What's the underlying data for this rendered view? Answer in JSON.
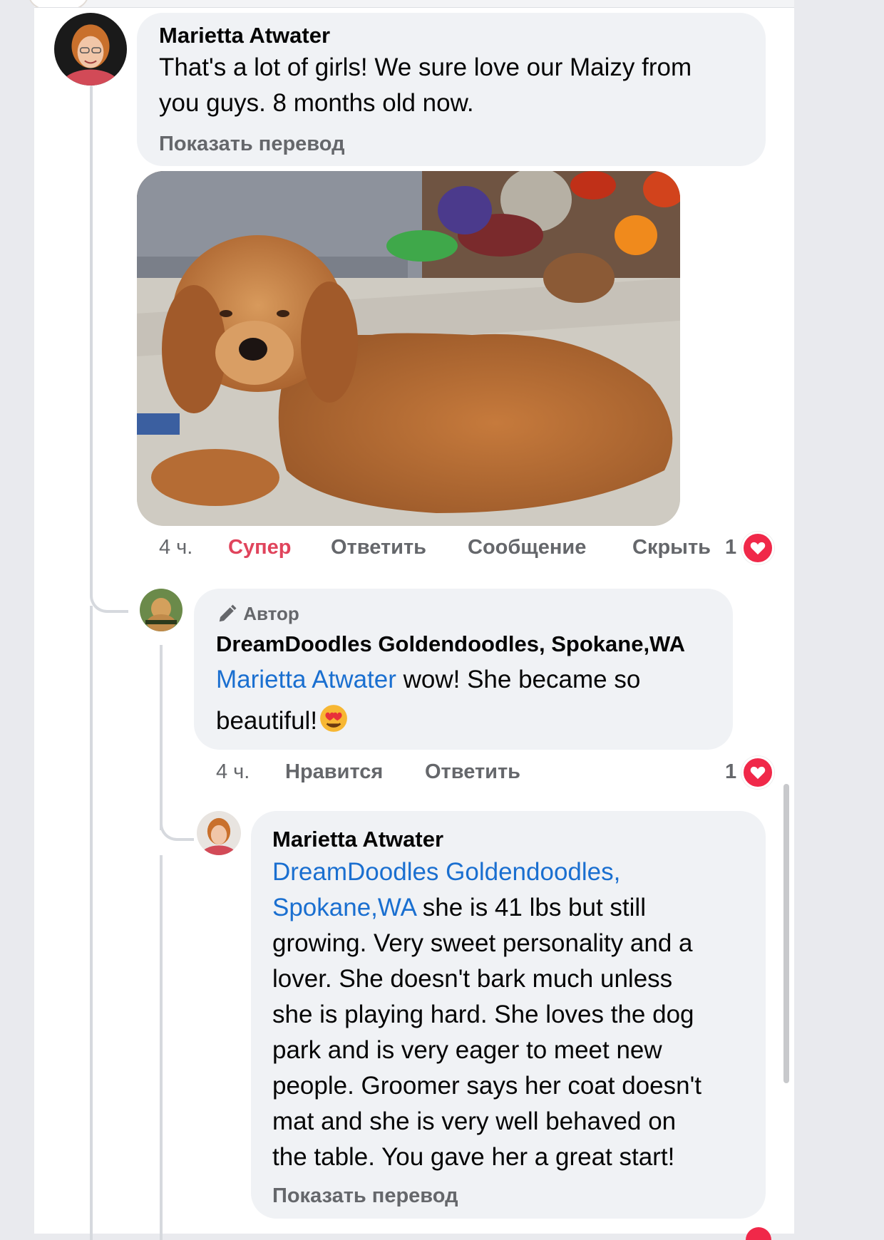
{
  "comment1": {
    "author": "Marietta Atwater",
    "line1": "That's a lot of girls! We sure love our Maizy from",
    "line2": "you guys. 8 months old now.",
    "translate": "Показать перевод",
    "photo_alt": "",
    "actions": {
      "time": "4 ч.",
      "react": "Супер",
      "reply": "Ответить",
      "message": "Сообщение",
      "hide": "Скрыть",
      "count": "1"
    }
  },
  "reply1": {
    "badge": "Автор",
    "author": "DreamDoodles Goldendoodles, Spokane,WA",
    "mention": "Marietta Atwater",
    "line1_rest": " wow! She became so",
    "line2": "beautiful!",
    "actions": {
      "time": "4 ч.",
      "like": "Нравится",
      "reply": "Ответить",
      "count": "1"
    }
  },
  "reply2": {
    "author": "Marietta Atwater",
    "mention_line1": "DreamDoodles Goldendoodles,",
    "mention_line2": "Spokane,WA",
    "line2_rest": " she is 41 lbs but still",
    "lines": [
      "growing. Very sweet personality and a",
      "lover. She doesn't bark much unless",
      "she is playing hard. She loves the dog",
      "park and is very eager to meet new",
      "people. Groomer says her coat doesn't",
      "mat and she is very well behaved on",
      "the table. You gave her a great start!"
    ],
    "translate": "Показать перевод"
  },
  "colors": {
    "link": "#1a6fd0",
    "react_active": "#e0445c",
    "heart": "#f02849",
    "meta_gray": "#65676b",
    "bubble": "#f0f2f5"
  }
}
